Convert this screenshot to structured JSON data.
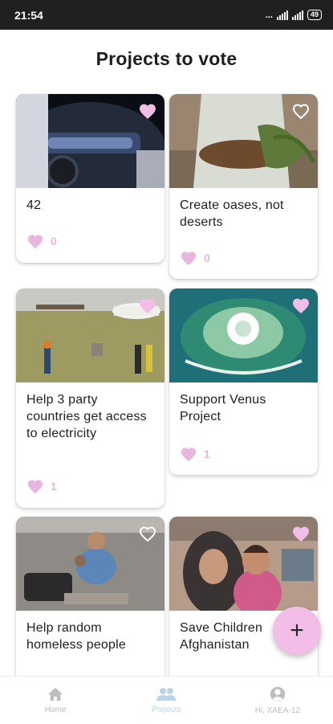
{
  "status_bar": {
    "time": "21:54",
    "network_dots": "...",
    "battery": "49"
  },
  "page_title": "Projects to vote",
  "projects": [
    {
      "title": "42",
      "likes": "0",
      "liked_icon": "heart-filled-icon"
    },
    {
      "title": "Create oases, not deserts",
      "likes": "0",
      "liked_icon": "heart-outline-icon"
    },
    {
      "title": "Help 3 party countries get access to electricity",
      "likes": "1",
      "liked_icon": "heart-filled-icon"
    },
    {
      "title": "Support Venus Project",
      "likes": "1",
      "liked_icon": "heart-filled-icon"
    },
    {
      "title": "Help random homeless people",
      "likes": "",
      "liked_icon": "heart-outline-icon"
    },
    {
      "title": "Save Children Afghanistan",
      "likes": "",
      "liked_icon": "heart-filled-icon"
    }
  ],
  "fab": {
    "label": "+"
  },
  "bottom_nav": {
    "items": [
      {
        "label": "Home",
        "icon": "home-icon"
      },
      {
        "label": "Projects",
        "icon": "people-icon"
      },
      {
        "label": "Hi, XAEA-12",
        "icon": "account-icon"
      }
    ],
    "active": "Projects"
  },
  "colors": {
    "accent_pink": "#f2bde6",
    "like_pink": "#e9b6df",
    "nav_active": "#b8d4ea"
  }
}
